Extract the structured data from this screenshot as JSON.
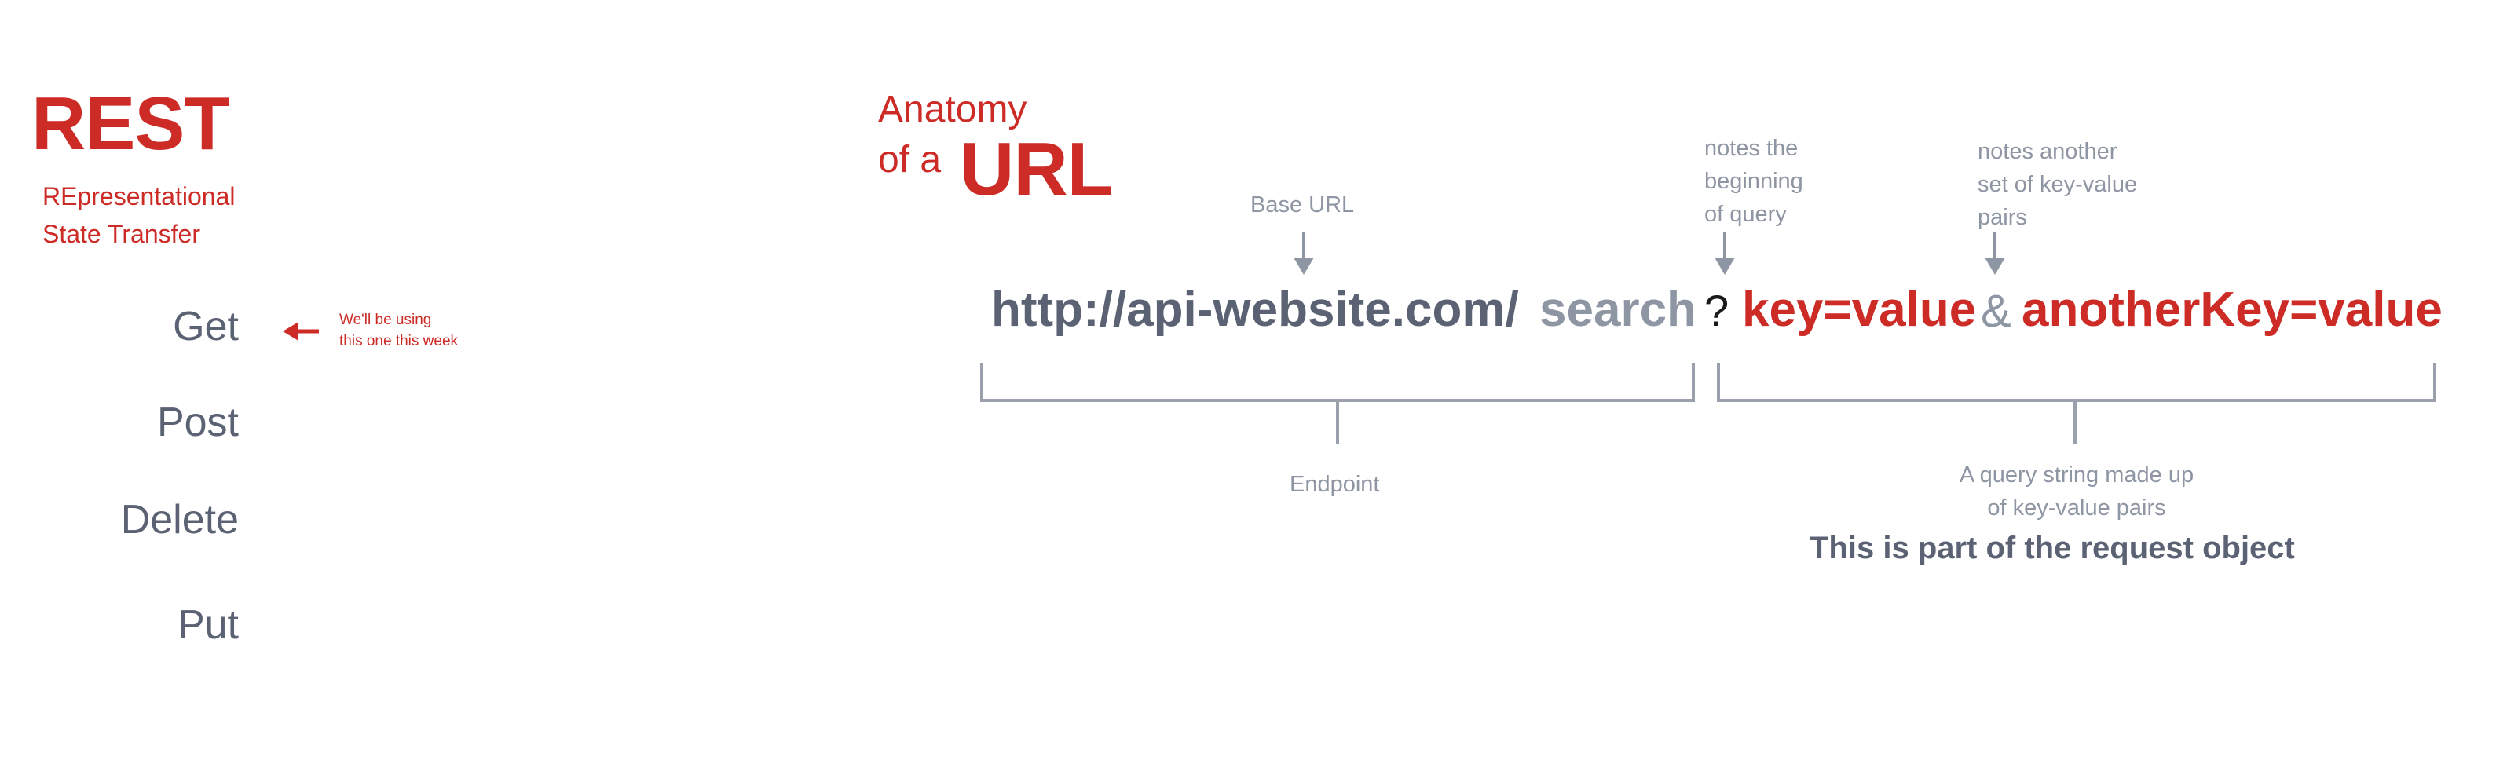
{
  "rest": {
    "title": "REST",
    "subtitle_line1": "REpresentational",
    "subtitle_line2": "State Transfer",
    "methods": [
      "Get",
      "Post",
      "Delete",
      "Put"
    ],
    "note_line1": "We'll be using",
    "note_line2": "this one this week"
  },
  "anatomy": {
    "title_line1": "Anatomy",
    "title_line2": "of a",
    "title_emphasis": "URL",
    "labels": {
      "base_url": "Base URL",
      "query_start_1": "notes the",
      "query_start_2": "beginning",
      "query_start_3": "of query",
      "another_pair_1": "notes another",
      "another_pair_2": "set of key-value",
      "another_pair_3": "pairs",
      "endpoint": "Endpoint",
      "query_string_1": "A query string made up",
      "query_string_2": "of  key-value pairs"
    },
    "url": {
      "base": "http://api-website.com/",
      "path": "search",
      "question": "?",
      "pair1": "key=value",
      "ampersand": "&",
      "pair2": "anotherKey=value"
    },
    "summary": "This is part of the request object"
  },
  "colors": {
    "accent_red": "#cc2b26",
    "slate": "#5b6273",
    "gray": "#8e95a3",
    "bracket": "#9aa1ad"
  }
}
